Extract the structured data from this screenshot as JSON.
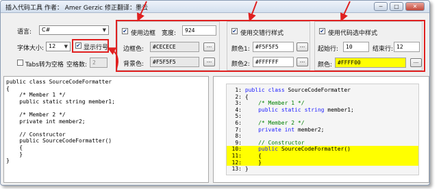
{
  "window": {
    "title": "插入代码工具 作者： Amer Gerzic 修正翻译：墨云",
    "controls": {
      "minimize": "─",
      "maximize": "□",
      "close": "✕"
    }
  },
  "settings": {
    "language_label": "语言:",
    "language_value": "C#",
    "font_size_label": "字体大小:",
    "font_size_value": "12",
    "show_line_numbers_label": "显示行号",
    "tabs_to_spaces_label": "Tabs转为空格",
    "space_count_label": "空格数:",
    "space_count_value": "2"
  },
  "border_group": {
    "enable_label": "使用边框",
    "width_label": "宽度:",
    "width_value": "924",
    "border_color_label": "边框色:",
    "border_color_value": "#CECECE",
    "bg_color_label": "背景色:",
    "bg_color_value": "#F5F5F5",
    "dots_label": "..."
  },
  "alt_rows_group": {
    "enable_label": "使用交错行样式",
    "color1_label": "颜色1:",
    "color1_value": "#F5F5F5",
    "color2_label": "颜色2:",
    "color2_value": "#FFFFFF",
    "dots_label": "..."
  },
  "highlight_group": {
    "enable_label": "使用代码选中样式",
    "start_label": "起始行:",
    "start_value": "10",
    "end_label": "结束行:",
    "end_value": "12",
    "color_label": "颜色:",
    "color_value": "#FFFF00",
    "dots_label": "..."
  },
  "source": {
    "lines": [
      "public class SourceCodeFormatter",
      "{",
      "    /* Member 1 */",
      "    public static string member1;",
      "",
      "    /* Member 2 */",
      "    private int member2;",
      "",
      "    // Constructor",
      "    public SourceCodeFormatter()",
      "    {",
      "    }",
      "}"
    ]
  },
  "preview": {
    "lines": [
      {
        "num": "1:",
        "text": "public class SourceCodeFormatter"
      },
      {
        "num": "2:",
        "text": "{"
      },
      {
        "num": "3:",
        "text": "    /* Member 1 */"
      },
      {
        "num": "4:",
        "text": "    public static string member1;"
      },
      {
        "num": "5:",
        "text": ""
      },
      {
        "num": "6:",
        "text": "    /* Member 2 */"
      },
      {
        "num": "7:",
        "text": "    private int member2;"
      },
      {
        "num": "8:",
        "text": ""
      },
      {
        "num": "9:",
        "text": "    // Constructor"
      },
      {
        "num": "10:",
        "text": "    public SourceCodeFormatter()"
      },
      {
        "num": "11:",
        "text": "    {"
      },
      {
        "num": "12:",
        "text": "    }"
      },
      {
        "num": "13:",
        "text": "}"
      }
    ]
  },
  "colors": {
    "highlight": "#FFFF00",
    "annotation_red": "#E02020",
    "keyword": "#2020FF",
    "comment": "#008000"
  }
}
